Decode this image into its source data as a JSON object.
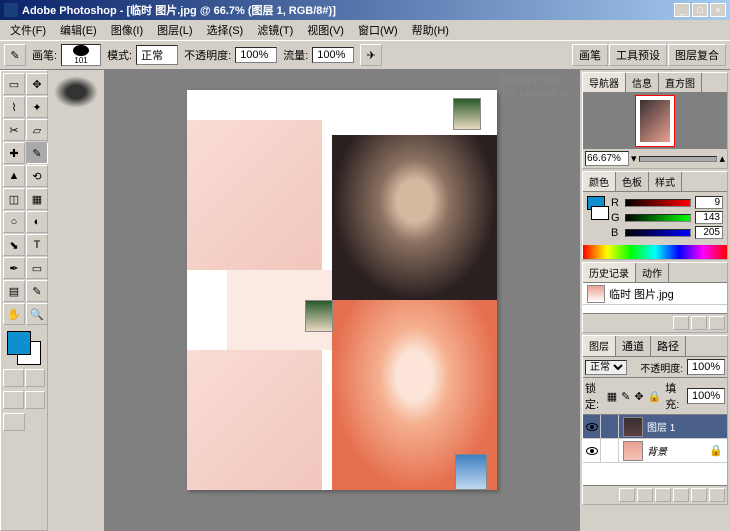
{
  "titlebar": {
    "app": "Adobe Photoshop",
    "doc": "[临时 图片.jpg @ 66.7% (图层 1, RGB/8#)]"
  },
  "menu": {
    "file": "文件(F)",
    "edit": "编辑(E)",
    "image": "图像(I)",
    "layer": "图层(L)",
    "select": "选择(S)",
    "filter": "滤镜(T)",
    "view": "视图(V)",
    "window": "窗口(W)",
    "help": "帮助(H)"
  },
  "options": {
    "brush_label": "画笔:",
    "brush_size": "101",
    "mode_label": "模式:",
    "mode_value": "正常",
    "opacity_label": "不透明度:",
    "opacity_value": "100%",
    "flow_label": "流量:",
    "flow_value": "100%",
    "tab_brush": "画笔",
    "tab_toolpreset": "工具预设",
    "tab_layercomp": "图层复合"
  },
  "navigator": {
    "tab_nav": "导航器",
    "tab_info": "信息",
    "tab_histogram": "直方图",
    "zoom": "66.67%"
  },
  "color": {
    "tab_color": "颜色",
    "tab_swatches": "色板",
    "tab_styles": "样式",
    "r_label": "R",
    "g_label": "G",
    "b_label": "B",
    "r": "9",
    "g": "143",
    "b": "205"
  },
  "history": {
    "tab_history": "历史记录",
    "tab_actions": "动作",
    "item": "临时 图片.jpg"
  },
  "layers": {
    "tab_layers": "图层",
    "tab_channels": "通道",
    "tab_paths": "路径",
    "blend": "正常",
    "opacity_label": "不透明度:",
    "opacity": "100%",
    "lock_label": "锁定:",
    "fill_label": "填充:",
    "fill": "100%",
    "layer1": "图层 1",
    "background": "背景"
  },
  "watermark": {
    "line1": "思缘设计论坛",
    "line2": "bbs.bovweb.cn"
  }
}
